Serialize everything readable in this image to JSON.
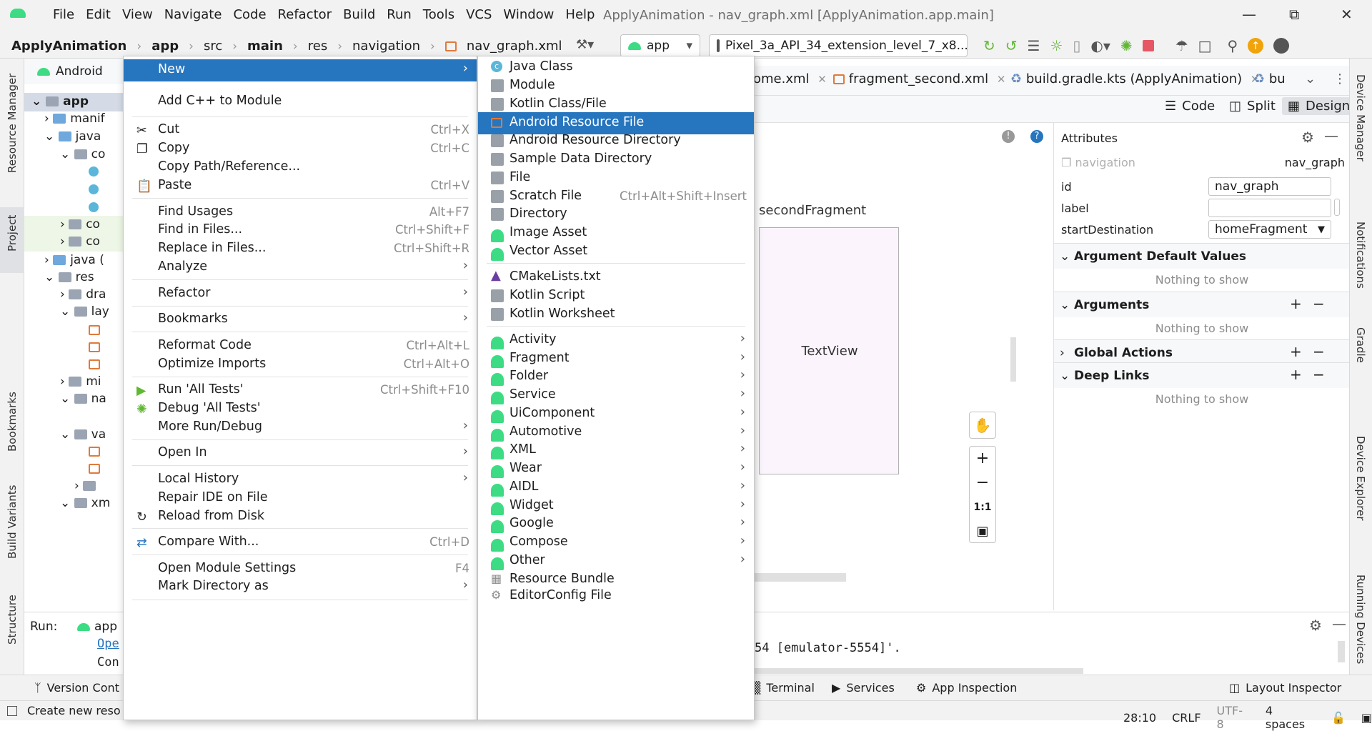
{
  "titlebar": {
    "menu": [
      "File",
      "Edit",
      "View",
      "Navigate",
      "Code",
      "Refactor",
      "Build",
      "Run",
      "Tools",
      "VCS",
      "Window",
      "Help"
    ],
    "title": "ApplyAnimation - nav_graph.xml [ApplyAnimation.app.main]"
  },
  "navbar": {
    "crumbs": [
      "ApplyAnimation",
      "app",
      "src",
      "main",
      "res",
      "navigation",
      "nav_graph.xml"
    ],
    "run_config": "app",
    "device": "Pixel_3a_API_34_extension_level_7_x8..."
  },
  "left_strip": {
    "resource_manager": "Resource Manager",
    "project": "Project",
    "bookmarks": "Bookmarks",
    "build_variants": "Build Variants",
    "structure": "Structure"
  },
  "right_strip": {
    "device_manager": "Device Manager",
    "notifications": "Notifications",
    "gradle": "Gradle",
    "device_explorer": "Device Explorer",
    "running_devices": "Running Devices"
  },
  "project": {
    "view": "Android",
    "items": [
      "app",
      "manif",
      "java",
      "co",
      "co",
      "co",
      "java (",
      "res",
      "dra",
      "lay",
      "mi",
      "na",
      "va",
      "xm"
    ]
  },
  "editor": {
    "tabs": [
      "ome.xml",
      "fragment_second.xml",
      "build.gradle.kts (ApplyAnimation)",
      "bu"
    ],
    "view_modes": [
      "Code",
      "Split",
      "Design"
    ],
    "fragment_label": "secondFragment",
    "textview": "TextView",
    "zoom_reset": "1:1"
  },
  "attributes": {
    "title": "Attributes",
    "type": "navigation",
    "type_value": "nav_graph",
    "rows": [
      {
        "label": "id",
        "value": "nav_graph"
      },
      {
        "label": "label",
        "value": ""
      },
      {
        "label": "startDestination",
        "value": "homeFragment"
      }
    ],
    "sections": [
      "Argument Default Values",
      "Arguments",
      "Global Actions",
      "Deep Links"
    ],
    "nothing": "Nothing to show"
  },
  "run": {
    "label": "Run:",
    "config": "app",
    "line1": "Ope",
    "line2": "Con",
    "console_text": "54 [emulator-5554]'."
  },
  "bottom_tools": [
    "Version Cont",
    "Terminal",
    "Services",
    "App Inspection",
    "Layout Inspector"
  ],
  "status": {
    "message": "Create new reso",
    "position": "28:10",
    "line_sep": "CRLF",
    "encoding": "UTF-8",
    "indent": "4 spaces"
  },
  "context_menu": {
    "new": "New",
    "add_cpp": "Add C++ to Module",
    "cut": "Cut",
    "cut_sc": "Ctrl+X",
    "copy": "Copy",
    "copy_sc": "Ctrl+C",
    "copy_path": "Copy Path/Reference...",
    "paste": "Paste",
    "paste_sc": "Ctrl+V",
    "find_usages": "Find Usages",
    "find_usages_sc": "Alt+F7",
    "find_in_files": "Find in Files...",
    "find_in_files_sc": "Ctrl+Shift+F",
    "replace_in_files": "Replace in Files...",
    "replace_in_files_sc": "Ctrl+Shift+R",
    "analyze": "Analyze",
    "refactor": "Refactor",
    "bookmarks": "Bookmarks",
    "reformat": "Reformat Code",
    "reformat_sc": "Ctrl+Alt+L",
    "optimize": "Optimize Imports",
    "optimize_sc": "Ctrl+Alt+O",
    "run_tests": "Run 'All Tests'",
    "run_tests_sc": "Ctrl+Shift+F10",
    "debug_tests": "Debug 'All Tests'",
    "more_run": "More Run/Debug",
    "open_in": "Open In",
    "local_history": "Local History",
    "repair": "Repair IDE on File",
    "reload": "Reload from Disk",
    "compare": "Compare With...",
    "compare_sc": "Ctrl+D",
    "module_settings": "Open Module Settings",
    "module_settings_sc": "F4",
    "mark_dir": "Mark Directory as"
  },
  "new_submenu": {
    "java_class": "Java Class",
    "module": "Module",
    "kotlin_class": "Kotlin Class/File",
    "android_resource_file": "Android Resource File",
    "android_resource_dir": "Android Resource Directory",
    "sample_data_dir": "Sample Data Directory",
    "file": "File",
    "scratch": "Scratch File",
    "scratch_sc": "Ctrl+Alt+Shift+Insert",
    "directory": "Directory",
    "image_asset": "Image Asset",
    "vector_asset": "Vector Asset",
    "cmake": "CMakeLists.txt",
    "kotlin_script": "Kotlin Script",
    "kotlin_worksheet": "Kotlin Worksheet",
    "activity": "Activity",
    "fragment": "Fragment",
    "folder": "Folder",
    "service": "Service",
    "uicomponent": "UiComponent",
    "automotive": "Automotive",
    "xml": "XML",
    "wear": "Wear",
    "aidl": "AIDL",
    "widget": "Widget",
    "google": "Google",
    "compose": "Compose",
    "other": "Other",
    "resource_bundle": "Resource Bundle",
    "editorconfig": "EditorConfig File"
  },
  "colors": {
    "accent": "#2675bf",
    "android_green": "#3ddc84",
    "stop_red": "#e55765",
    "build_green": "#5fb832"
  }
}
